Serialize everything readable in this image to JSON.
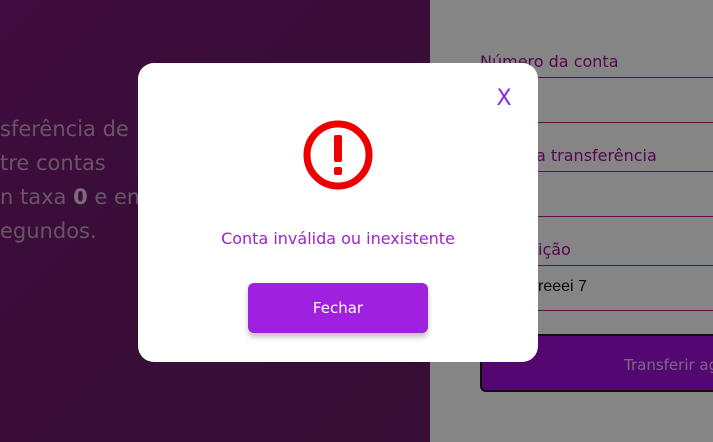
{
  "hero": {
    "line1": "sferência de",
    "line2": "tre contas",
    "line3_pre": "n taxa ",
    "line3_bold": "0",
    "line3_post": " e em",
    "line4": "egundos."
  },
  "form": {
    "account_number_label": "Número da conta",
    "transfer_value_label": "a transferência",
    "description_label": "ição",
    "description_value": "reeei 7",
    "submit_label": "Transferir ag"
  },
  "modal": {
    "close_symbol": "X",
    "message": "Conta inválida ou inexistente",
    "close_button_label": "Fechar",
    "icon": "exclamation-circle-icon",
    "icon_color": "#ee0000"
  },
  "colors": {
    "accent": "#a020e0",
    "label": "#a50d9a"
  }
}
